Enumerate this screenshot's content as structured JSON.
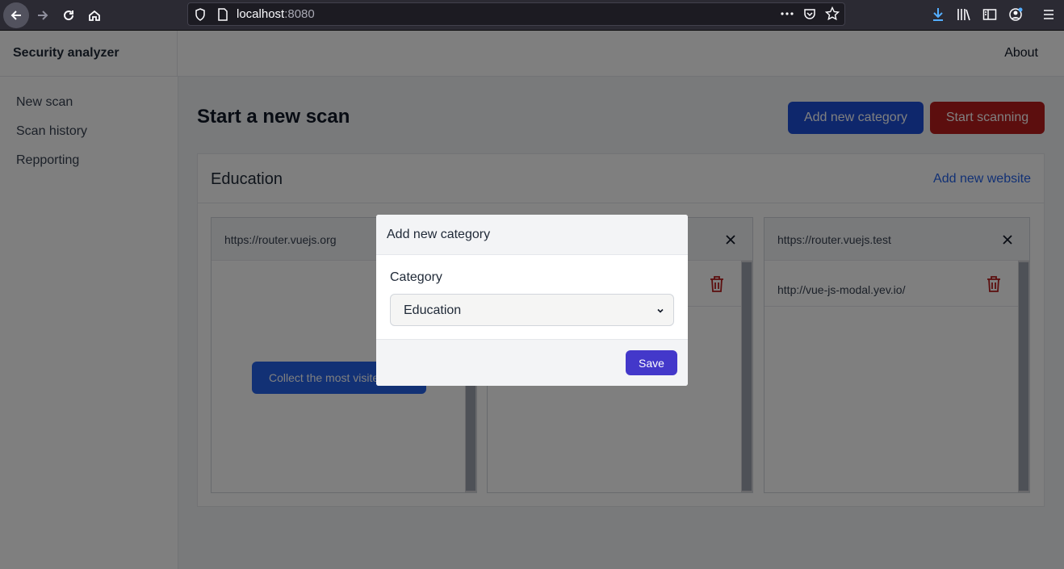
{
  "browser": {
    "url_host": "localhost",
    "url_port": ":8080"
  },
  "header": {
    "brand": "Security analyzer",
    "about": "About"
  },
  "sidebar": {
    "items": [
      {
        "label": "New scan"
      },
      {
        "label": "Scan history"
      },
      {
        "label": "Repporting"
      }
    ]
  },
  "main": {
    "title": "Start a new scan",
    "add_category_label": "Add new category",
    "start_scanning_label": "Start scanning",
    "category": {
      "name": "Education",
      "add_website_label": "Add new website",
      "sites": [
        {
          "url": "https://router.vuejs.org",
          "action_label": "Collect the most visited"
        },
        {
          "url": "",
          "links": [
            ""
          ]
        },
        {
          "url": "https://router.vuejs.test",
          "links": [
            "http://vue-js-modal.yev.io/"
          ]
        }
      ]
    }
  },
  "modal": {
    "title": "Add new category",
    "field_label": "Category",
    "selected_value": "Education",
    "save_label": "Save"
  },
  "colors": {
    "primary": "#1d4ed8",
    "danger": "#b91c1c",
    "save": "#4338ca",
    "link": "#2563eb"
  }
}
